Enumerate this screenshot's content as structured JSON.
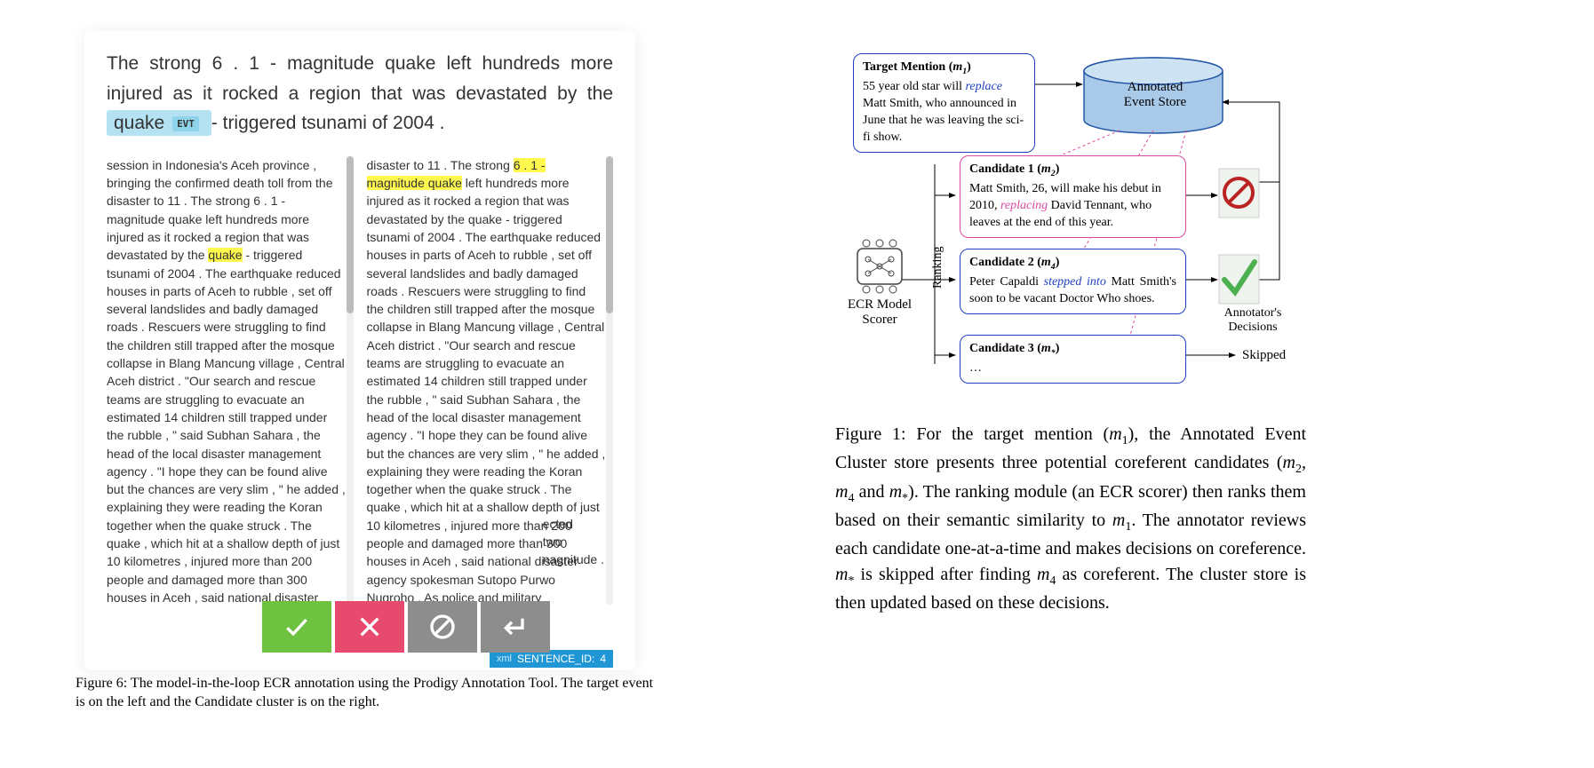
{
  "main_sentence": {
    "pre": "The strong 6 . 1 - magnitude quake left hundreds more injured as it rocked a region that was devastated by the ",
    "highlighted_word": "quake",
    "evt_label": "EVT",
    "post": " - triggered tsunami of 2004 ."
  },
  "left_column": {
    "text_before": "session in Indonesia's Aceh province , bringing the confirmed death toll from the disaster to 11 . The strong 6 . 1 - magnitude quake left hundreds more injured as it rocked a region that was devastated by the ",
    "highlight": "quake",
    "text_after": " - triggered tsunami of 2004 . The earthquake reduced houses in parts of Aceh to rubble , set off several landslides and badly damaged roads . Rescuers were struggling to find the children still trapped after the mosque collapse in Blang Mancung village , Central Aceh district . \"Our search and rescue teams are struggling to evacuate an estimated 14 children still trapped under the rubble , \" said Subhan Sahara , the head of the local disaster management agency . \"I hope they can be found alive but the chances are very slim , \" he added , explaining they were reading the Koran together when the quake struck . The quake , which hit at a shallow depth of just 10 kilometres , injured more than 200 people and damaged more than 300 houses in Aceh , said national disaster agency spokesman Sutopo Purwo Nugroho . As police and military personnel struggled"
  },
  "right_column": {
    "text_before": "disaster to 11 . The strong ",
    "highlight": "6 . 1 - magnitude quake",
    "text_after": " left hundreds more injured as it rocked a region that was devastated by the quake - triggered tsunami of 2004 . The earthquake reduced houses in parts of Aceh to rubble , set off several landslides and badly damaged roads . Rescuers were struggling to find the children still trapped after the mosque collapse in Blang Mancung village , Central Aceh district . \"Our search and rescue teams are struggling to evacuate an estimated 14 children still trapped under the rubble , \" said Subhan Sahara , the head of the local disaster management agency . \"I hope they can be found alive but the chances are very slim , \" he added , explaining they were reading the Koran together when the quake struck . The quake , which hit at a shallow depth of just 10 kilometres , injured more than 200 people and damaged more than 300 houses in Aceh , said national disaster agency spokesman Sutopo Purwo Nugroho . As police and military",
    "tail1": "ected",
    "tail2": "two",
    "tail3": "nagnitude ."
  },
  "sentence_id": {
    "xml": "xml",
    "label": "SENTENCE_ID:",
    "value": "4"
  },
  "fig6_caption": "Figure 6: The model-in-the-loop ECR annotation using the Prodigy Annotation Tool. The target event is on the left and the Candidate cluster is on the right.",
  "diagram": {
    "target": {
      "title_pre": "Target Mention (",
      "title_var": "m",
      "title_sub": "1",
      "title_post": ")",
      "text_pre": "55 year old star will ",
      "text_em": "replace",
      "text_post": " Matt Smith, who announced in June that he was leaving the sci-fi show."
    },
    "store": {
      "line1": "Annotated",
      "line2": "Event Store"
    },
    "cand1": {
      "title_pre": "Candidate 1 (",
      "title_var": "m",
      "title_sub": "2",
      "title_post": ")",
      "text_pre": "Matt Smith, 26, will make his debut in 2010, ",
      "text_em": "replacing",
      "text_post": " David Tennant, who leaves at the end of this year."
    },
    "cand2": {
      "title_pre": "Candidate 2 (",
      "title_var": "m",
      "title_sub": "4",
      "title_post": ")",
      "text_pre": "Peter Capaldi ",
      "text_em": "stepped into",
      "text_post": " Matt Smith's soon to be vacant Doctor Who shoes."
    },
    "cand3": {
      "title_pre": "Candidate 3 (",
      "title_var": "m",
      "title_sub": "*",
      "title_post": ")",
      "text": "…"
    },
    "ecr_label1": "ECR Model",
    "ecr_label2": "Scorer",
    "ranking_label": "Ranking",
    "decisions_label1": "Annotator's",
    "decisions_label2": "Decisions",
    "skipped_label": "Skipped"
  },
  "fig1_caption": {
    "p1": "Figure 1: For the target mention (",
    "p2": "), the Annotated Event Cluster store presents three potential coreferent candidates (",
    "p3": " and ",
    "p4": "). The ranking module (an ECR scorer) then ranks them based on their semantic similarity to ",
    "p5": ". The annotator reviews each candidate one-at-a-time and makes decisions on coreference. ",
    "p6": " is skipped after finding ",
    "p7": " as coreferent. The cluster store is then updated based on these decisions."
  }
}
